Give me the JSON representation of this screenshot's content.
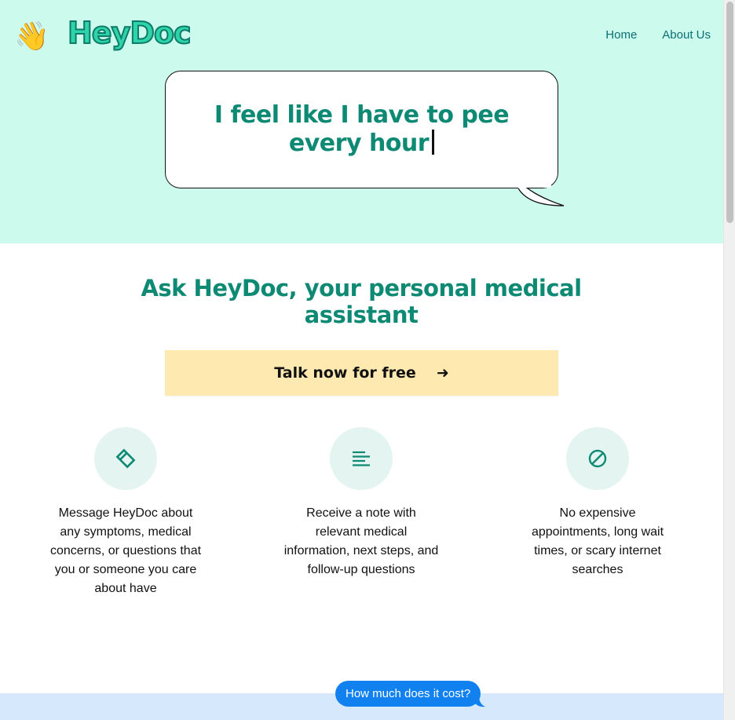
{
  "brand": {
    "name": "HeyDoc",
    "wave_icon": "waving-hand-icon",
    "wave_glyph": "👋"
  },
  "nav": {
    "items": [
      {
        "label": "Home"
      },
      {
        "label": "About Us"
      }
    ]
  },
  "hero": {
    "typed_message": "I feel like I have to pee every hour"
  },
  "headline": "Ask HeyDoc, your personal medical assistant",
  "cta": {
    "label": "Talk now for free",
    "arrow": "➜"
  },
  "features": [
    {
      "icon": "tag-icon",
      "text": "Message HeyDoc about any symptoms, medical concerns, or questions that you or someone you care about have"
    },
    {
      "icon": "text-lines-icon",
      "text": "Receive a note with relevant medical information, next steps, and follow-up questions"
    },
    {
      "icon": "prohibited-icon",
      "text": "No expensive appointments, long wait times, or scary internet searches"
    }
  ],
  "chat_bubble": {
    "text": "How much does it cost?"
  },
  "colors": {
    "hero_bg": "#ccfaec",
    "accent": "#0e8a74",
    "cta_bg": "#feeab0",
    "feature_circle": "#e3f4f1",
    "chat_blue": "#1181ef",
    "bottom_band": "#d6e8fc"
  }
}
